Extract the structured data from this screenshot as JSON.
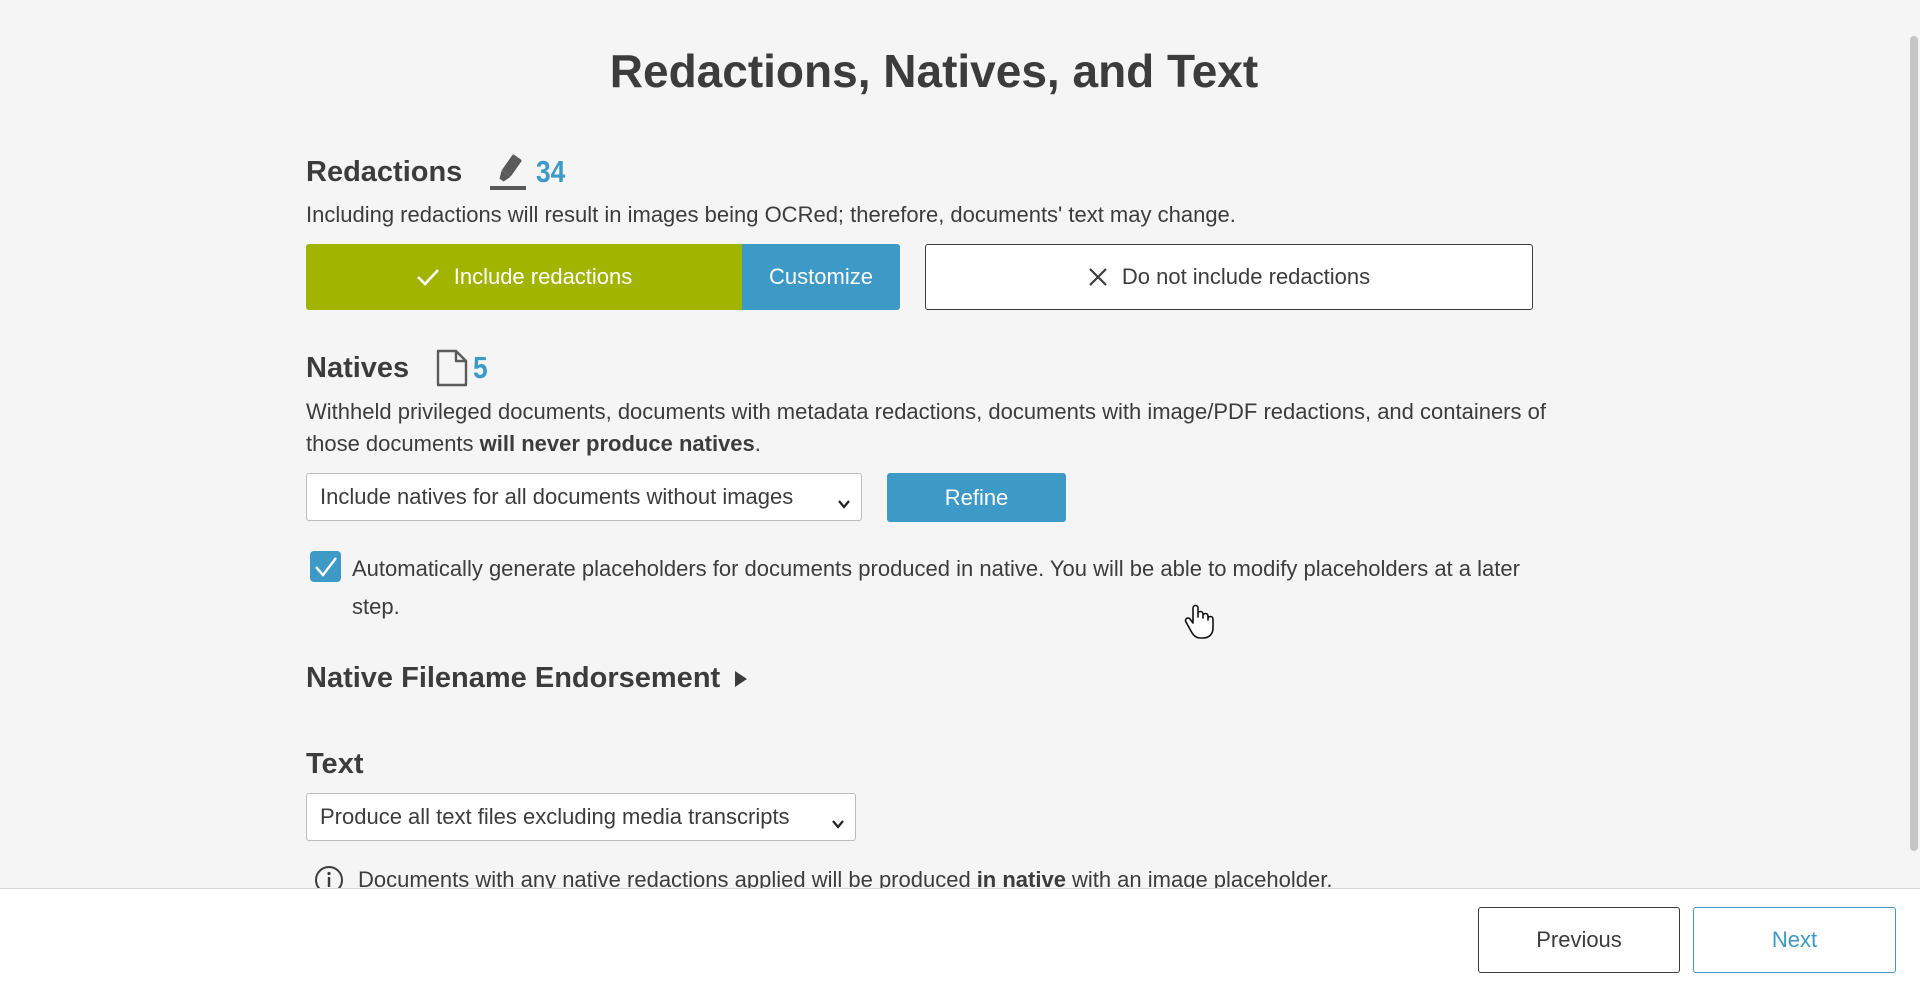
{
  "page": {
    "title": "Redactions, Natives, and Text"
  },
  "redactions": {
    "heading": "Redactions",
    "count": "34",
    "description": "Including redactions will result in images being OCRed; therefore, documents' text may change.",
    "include_label": "Include redactions",
    "customize_label": "Customize",
    "exclude_label": "Do not include redactions"
  },
  "natives": {
    "heading": "Natives",
    "count": "5",
    "description_start": "Withheld privileged documents, documents with metadata redactions, documents with image/PDF redactions, and containers of those documents ",
    "description_bold": "will never produce natives",
    "description_end": ".",
    "select_value": "Include natives for all documents without images",
    "refine_label": "Refine",
    "placeholder_checkbox_checked": true,
    "placeholder_label": "Automatically generate placeholders for documents produced in native. You will be able to modify placeholders at a later step."
  },
  "native_filename_endorsement": {
    "heading": "Native Filename Endorsement"
  },
  "text": {
    "heading": "Text",
    "select_value": "Produce all text files excluding media transcripts",
    "info_start": "Documents with any native redactions applied will be produced ",
    "info_bold": "in native",
    "info_end": " with an image placeholder."
  },
  "footer": {
    "previous_label": "Previous",
    "next_label": "Next"
  },
  "colors": {
    "accent_blue": "#3d9ac6",
    "accent_green": "#a1b400",
    "text": "#3c3c3c"
  },
  "icons": [
    "highlighter-icon",
    "document-icon",
    "checkmark-icon",
    "close-icon",
    "chevron-down-icon",
    "triangle-right-icon",
    "info-icon",
    "hand-cursor-icon"
  ]
}
